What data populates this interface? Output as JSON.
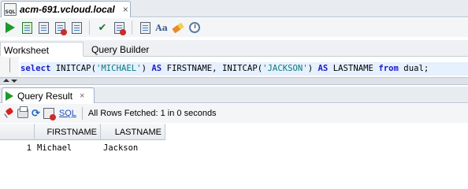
{
  "document_tab": {
    "title": "acm-691.vcloud.local",
    "close": "×",
    "icon": "sql-file-icon"
  },
  "toolbar": {
    "buttons": [
      "run-statement-icon",
      "run-script-icon",
      "commit-icon",
      "rollback-icon",
      "unshared-sql-icon",
      "explain-plan-icon",
      "autotrace-icon",
      "sql-tuning-icon",
      "to-upper-case-icon",
      "clear-icon",
      "sql-history-icon"
    ]
  },
  "sub_tabs": {
    "worksheet": "Worksheet",
    "query_builder": "Query Builder"
  },
  "editor": {
    "tokens": [
      {
        "t": "select",
        "k": "kw"
      },
      {
        "t": " INITCAP(",
        "k": "plain"
      },
      {
        "t": "'MICHAEL'",
        "k": "str"
      },
      {
        "t": ") ",
        "k": "plain"
      },
      {
        "t": "AS",
        "k": "kw"
      },
      {
        "t": " FIRSTNAME, INITCAP(",
        "k": "plain"
      },
      {
        "t": "'JACKSON'",
        "k": "str"
      },
      {
        "t": ") ",
        "k": "plain"
      },
      {
        "t": "AS",
        "k": "kw"
      },
      {
        "t": " LASTNAME ",
        "k": "plain"
      },
      {
        "t": "from",
        "k": "kw"
      },
      {
        "t": " dual;",
        "k": "plain"
      }
    ]
  },
  "results_tab": {
    "label": "Query Result",
    "close": "×"
  },
  "results_toolbar": {
    "sql_link": "SQL",
    "status": "All Rows Fetched: 1 in 0 seconds"
  },
  "grid": {
    "columns": [
      "FIRSTNAME",
      "LASTNAME"
    ],
    "rows": [
      {
        "num": "1",
        "FIRSTNAME": "Michael",
        "LASTNAME": "Jackson"
      }
    ]
  }
}
